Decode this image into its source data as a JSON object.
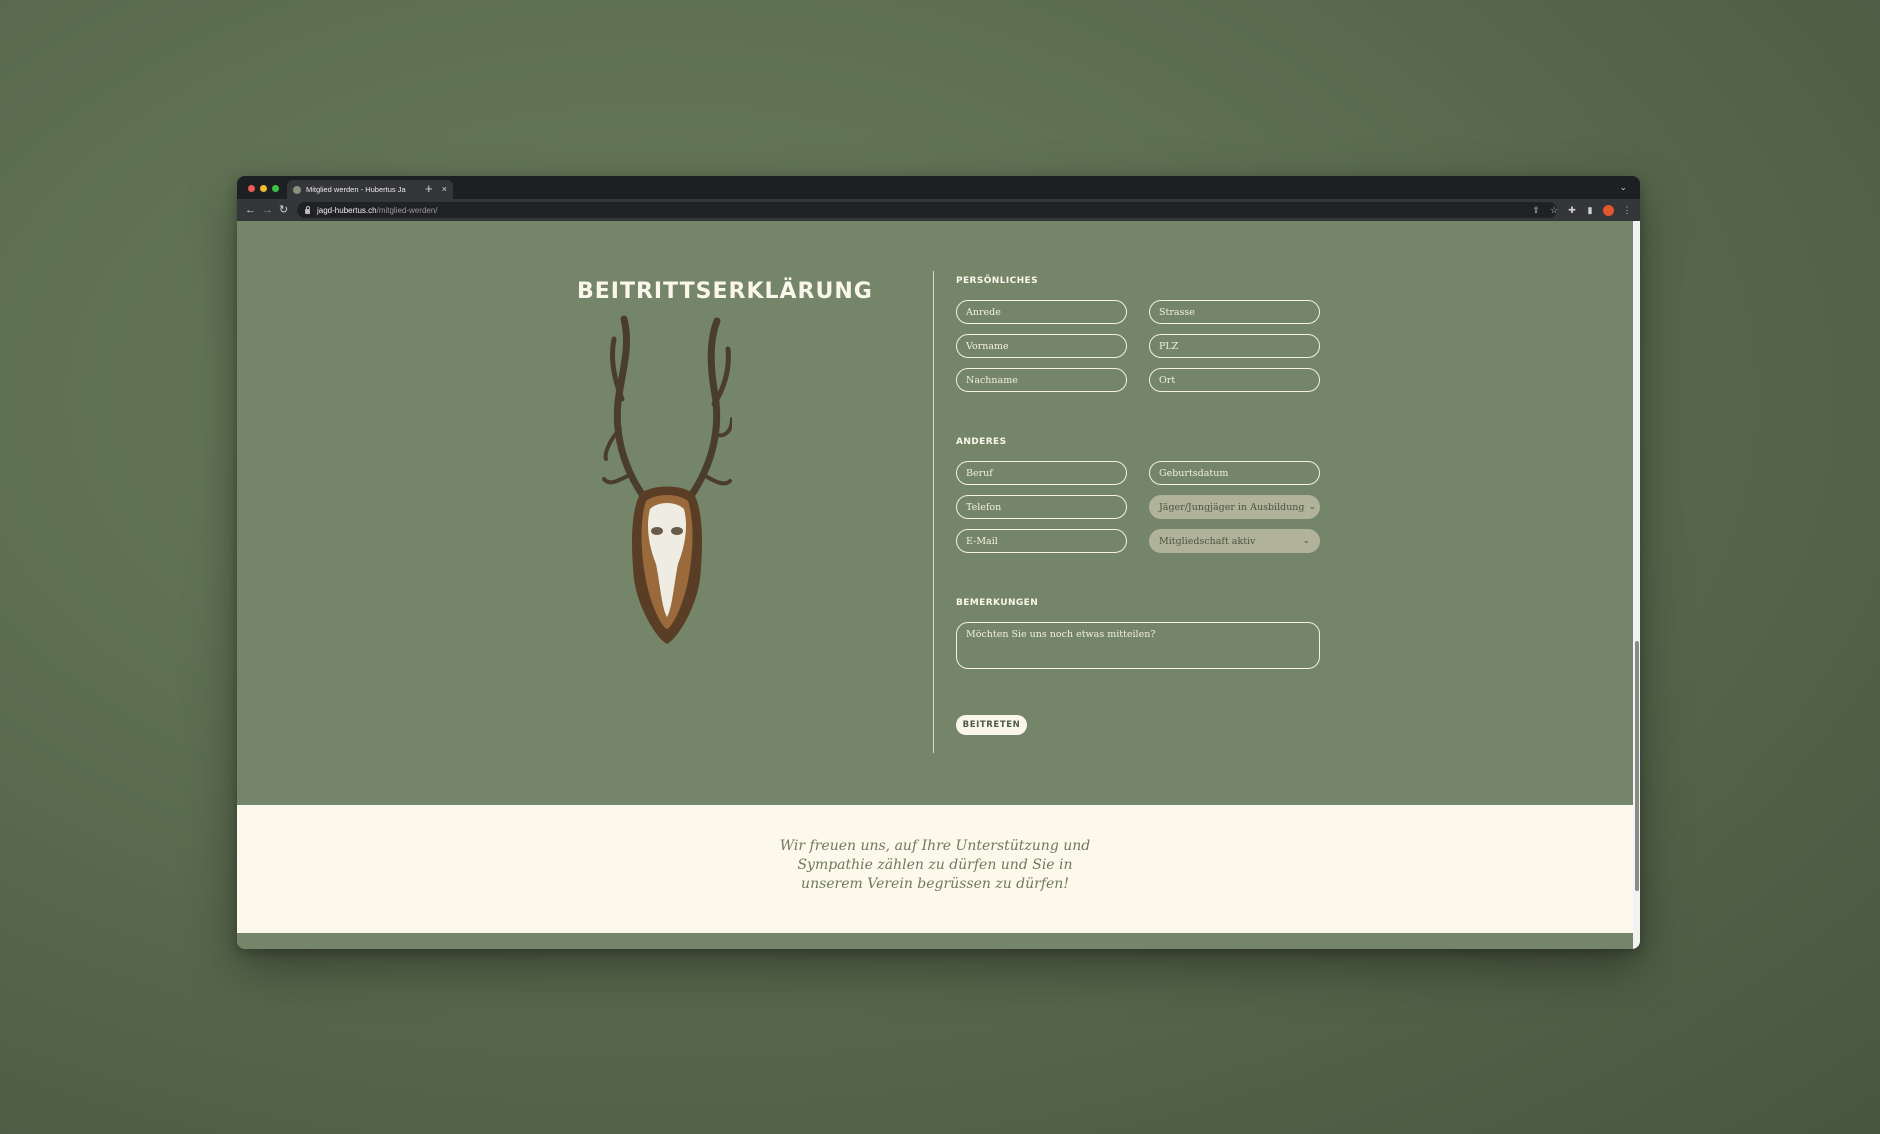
{
  "browser": {
    "tab_title": "Mitglied werden - Hubertus Ja",
    "tab_close": "×",
    "new_tab": "+",
    "url_host": "jagd-hubertus.ch",
    "url_path": "/mitglied-werden/",
    "back": "←",
    "forward": "→",
    "reload": "↻",
    "profile_color": "#e2572d"
  },
  "page": {
    "title": "BEITRITTSERKLÄRUNG",
    "sections": {
      "personal_heading": "PERSÖNLICHES",
      "other_heading": "ANDERES",
      "remarks_heading": "BEMERKUNGEN"
    },
    "fields": {
      "anrede": "Anrede",
      "strasse": "Strasse",
      "vorname": "Vorname",
      "plz": "PLZ",
      "nachname": "Nachname",
      "ort": "Ort",
      "beruf": "Beruf",
      "geburtsdatum": "Geburtsdatum",
      "telefon": "Telefon",
      "jaeger_select": "Jäger/Jungjäger in Ausbildung",
      "email": "E-Mail",
      "mitgliedschaft_select": "Mitgliedschaft aktiv",
      "remarks_placeholder": "Möchten Sie uns noch etwas mitteilen?"
    },
    "submit_label": "BEITRETEN",
    "welcome_text": "Wir freuen uns, auf Ihre Unterstützung und Sympathie zählen zu dürfen und Sie in unserem Verein begrüssen zu dürfen!"
  },
  "colors": {
    "page_green": "#74856a",
    "cream": "#fdf8ec",
    "select_bg": "#b0b29a"
  }
}
